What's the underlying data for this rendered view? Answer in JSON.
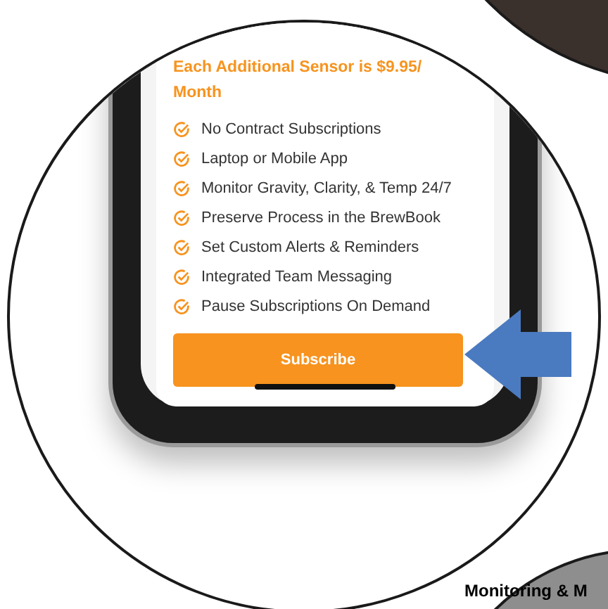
{
  "price_note": "Each Additional Sensor is $9.95/ Month",
  "features": [
    "No Contract Subscriptions",
    "Laptop or Mobile App",
    "Monitor Gravity, Clarity, & Temp 24/7",
    "Preserve Process in the BrewBook",
    "Set Custom Alerts & Reminders",
    "Integrated Team Messaging",
    "Pause Subscriptions On Demand"
  ],
  "subscribe_button": "Subscribe",
  "next_section_title": "Monitoring & M"
}
